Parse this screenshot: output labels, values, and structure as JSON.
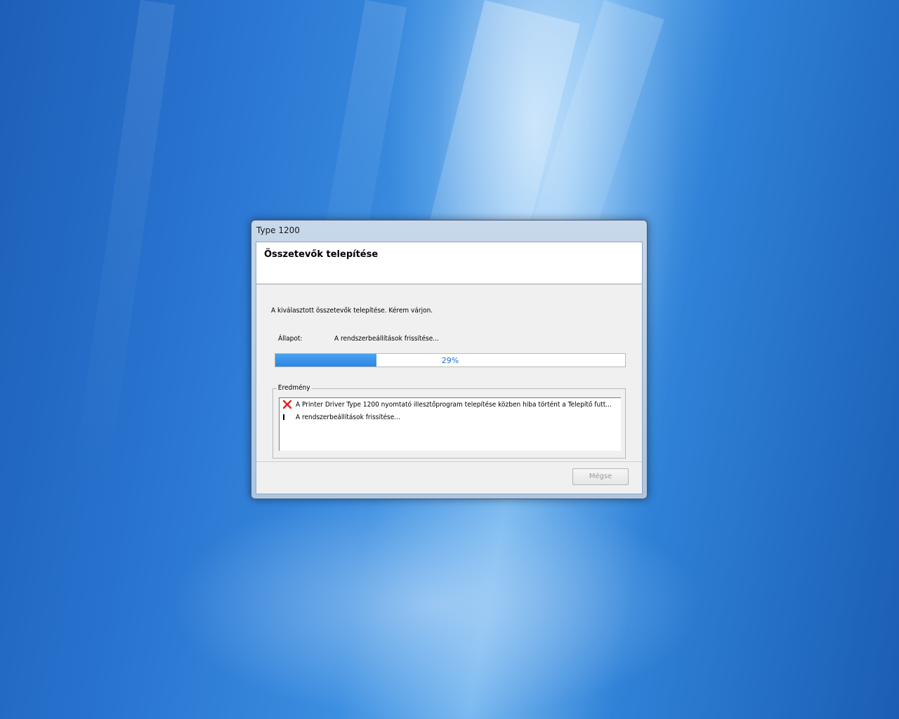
{
  "window": {
    "title": "Type 1200"
  },
  "header": {
    "title": "Összetevők telepítése"
  },
  "instruction": "A kiválasztott összetevők telepítése. Kérem várjon.",
  "status": {
    "label": "Állapot:",
    "value": "A rendszerbeállítások frissítése..."
  },
  "progress": {
    "percent": 29,
    "label": "29%",
    "color": "#2c84e2"
  },
  "results": {
    "group_label": "Eredmény",
    "items": [
      {
        "icon": "error-x-icon",
        "text": "A Printer Driver Type 1200 nyomtató illesztőprogram telepítése közben hiba történt a Telepítő futt..."
      },
      {
        "icon": "in-progress-bar-icon",
        "text": "A rendszerbeállítások frissítése..."
      }
    ]
  },
  "buttons": {
    "cancel_label": "Mégse"
  },
  "colors": {
    "error": "#e02020",
    "desktop": "#2a76d2"
  }
}
